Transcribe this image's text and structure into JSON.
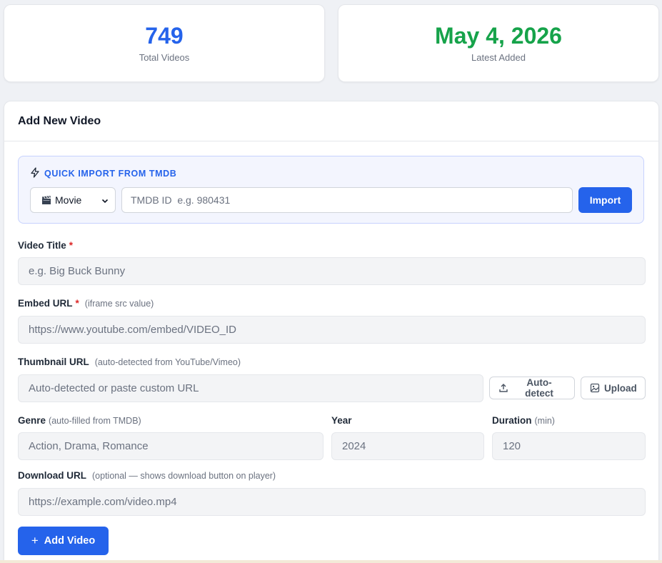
{
  "stats": {
    "total": {
      "value": "749",
      "label": "Total Videos",
      "color": "#2563eb"
    },
    "latest": {
      "value": "May 4, 2026",
      "label": "Latest Added",
      "color": "#16a34a"
    }
  },
  "form": {
    "title": "Add New Video",
    "import": {
      "heading": "QUICK IMPORT FROM TMDB",
      "heading_icon": "lightning-icon",
      "type_selected": "Movie",
      "type_icon": "clapperboard-icon",
      "tmdb_placeholder": "TMDB ID  e.g. 980431",
      "button": "Import"
    },
    "video_title": {
      "label": "Video Title",
      "required": "*",
      "placeholder": "e.g. Big Buck Bunny"
    },
    "embed_url": {
      "label": "Embed URL",
      "required": "*",
      "hint": "(iframe src value)",
      "placeholder": "https://www.youtube.com/embed/VIDEO_ID"
    },
    "thumbnail": {
      "label": "Thumbnail URL",
      "hint": "(auto-detected from YouTube/Vimeo)",
      "placeholder": "Auto-detected or paste custom URL",
      "auto_detect": "Auto-detect",
      "upload": "Upload"
    },
    "genre": {
      "label": "Genre",
      "hint": "(auto-filled from TMDB)",
      "placeholder": "Action, Drama, Romance"
    },
    "year": {
      "label": "Year",
      "placeholder": "2024"
    },
    "duration": {
      "label": "Duration",
      "hint": "(min)",
      "placeholder": "120"
    },
    "download": {
      "label": "Download URL",
      "hint": "(optional — shows download button on player)",
      "placeholder": "https://example.com/video.mp4"
    },
    "submit": {
      "icon": "+",
      "label": "Add Video"
    }
  },
  "colors": {
    "accent": "#2563eb",
    "success": "#16a34a",
    "required": "#dc2626"
  }
}
